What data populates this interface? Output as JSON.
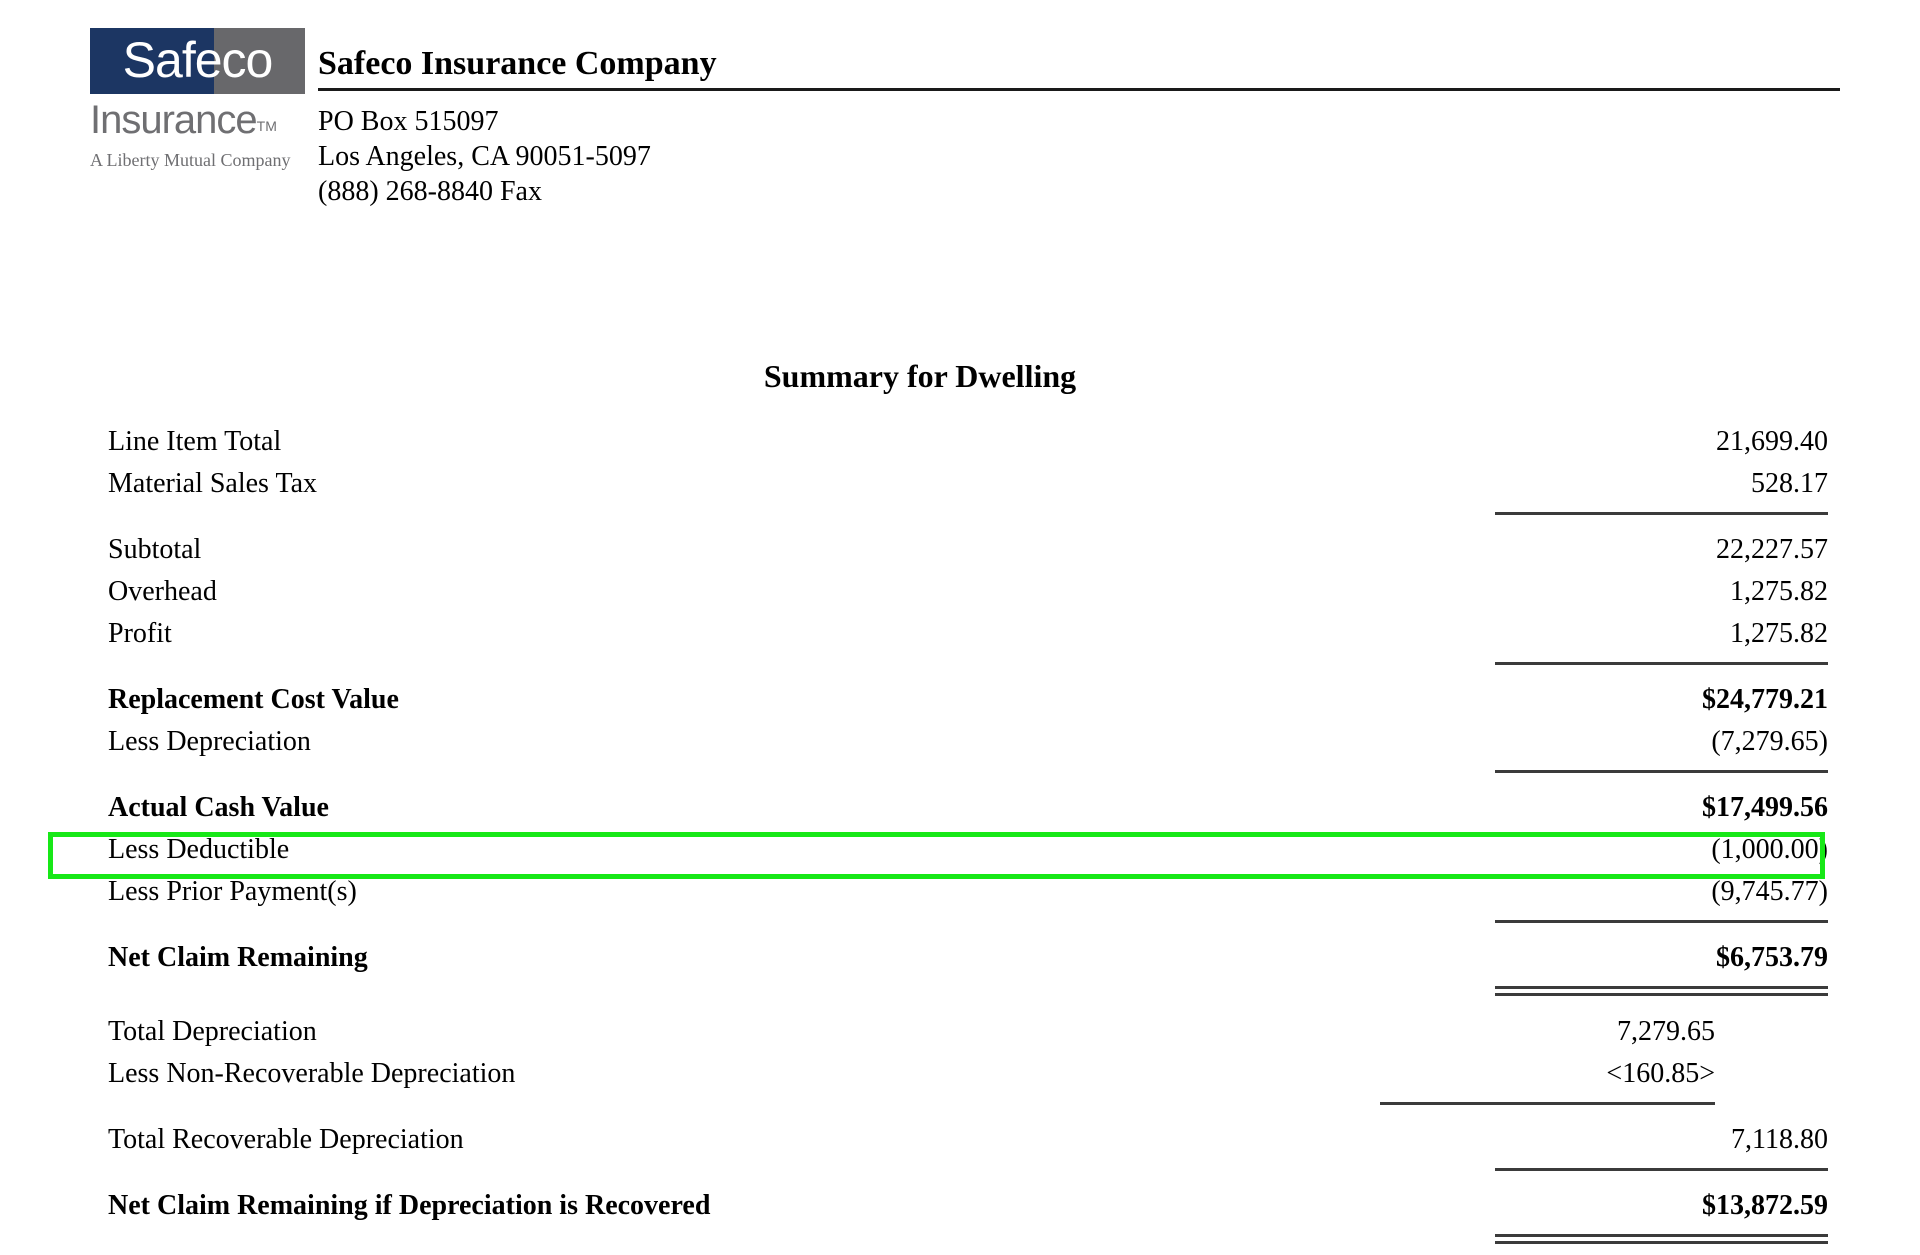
{
  "letterhead": {
    "logo": {
      "wordmark_primary": "Safeco",
      "wordmark_secondary": "Insurance",
      "trademark": "TM",
      "tagline": "A Liberty Mutual Company",
      "navy_hex": "#1C3663",
      "gray_hex": "#68686B"
    },
    "company_name": "Safeco Insurance Company",
    "address": [
      "PO Box  515097",
      "Los Angeles, CA  90051-5097",
      "(888) 268-8840 Fax"
    ]
  },
  "summary": {
    "title": "Summary for Dwelling",
    "rows": [
      {
        "label": "Line Item Total",
        "value": "21,699.40"
      },
      {
        "label": "Material Sales Tax",
        "value": "528.17"
      },
      {
        "label": "Subtotal",
        "value": "22,227.57"
      },
      {
        "label": "Overhead",
        "value": "1,275.82"
      },
      {
        "label": "Profit",
        "value": "1,275.82"
      },
      {
        "label": "Replacement Cost Value",
        "value": "$24,779.21"
      },
      {
        "label": "Less Depreciation",
        "value": "(7,279.65)"
      },
      {
        "label": "Actual Cash Value",
        "value": "$17,499.56"
      },
      {
        "label": "Less Deductible",
        "value": "(1,000.00)"
      },
      {
        "label": "Less Prior Payment(s)",
        "value": "(9,745.77)"
      },
      {
        "label": "Net Claim Remaining",
        "value": "$6,753.79"
      },
      {
        "label": "Total Depreciation",
        "value": "7,279.65"
      },
      {
        "label": "Less Non-Recoverable Depreciation",
        "value": "<160.85>"
      },
      {
        "label": "Total Recoverable Depreciation",
        "value": "7,118.80"
      },
      {
        "label": "Net Claim Remaining if Depreciation is Recovered",
        "value": "$13,872.59"
      }
    ]
  },
  "highlight": {
    "target_label": "Less Deductible",
    "color_hex": "#17E817"
  }
}
